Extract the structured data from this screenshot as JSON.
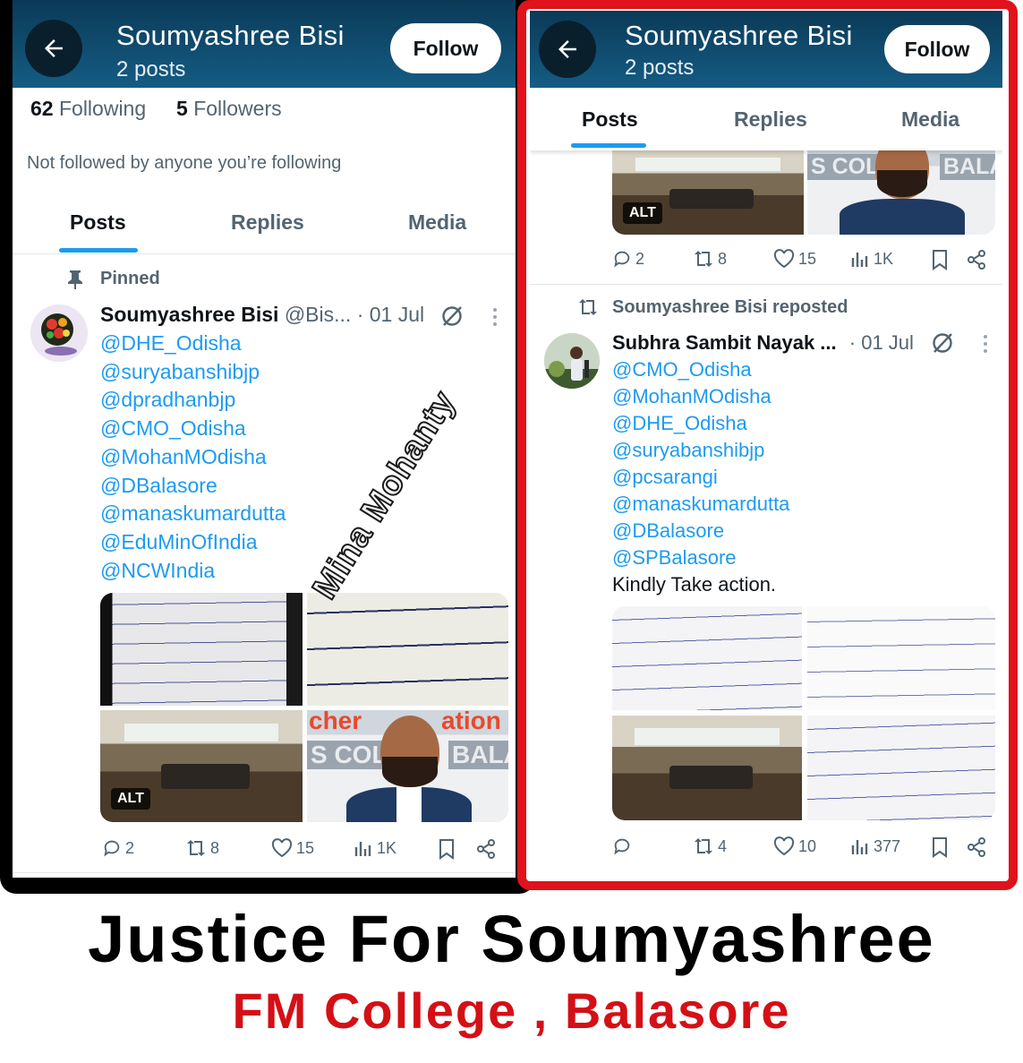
{
  "left_panel": {
    "header": {
      "name": "Soumyashree Bisi",
      "posts": "2 posts",
      "follow_label": "Follow"
    },
    "stats": {
      "following_count": "62",
      "following_label": "Following",
      "followers_count": "5",
      "followers_label": "Followers"
    },
    "not_followed_text": "Not followed by anyone you’re following",
    "tabs": [
      "Posts",
      "Replies",
      "Media"
    ],
    "pinned_label": "Pinned",
    "post": {
      "author": "Soumyashree Bisi",
      "handle": "@Bis...",
      "date": "· 01 Jul",
      "mentions": [
        "@DHE_Odisha",
        "@suryabanshibjp",
        "@dpradhanbjp",
        "@CMO_Odisha",
        "@MohanMOdisha",
        "@DBalasore",
        "@manaskumardutta",
        "@EduMinOfIndia",
        "@NCWIndia"
      ],
      "alt_badge": "ALT",
      "image_text_1": "cher",
      "image_text_2": "ation",
      "image_text_3": "S COLL",
      "image_text_4": "BALA",
      "replies": "2",
      "reposts": "8",
      "likes": "15",
      "views": "1K"
    }
  },
  "right_panel": {
    "header": {
      "name": "Soumyashree Bisi",
      "posts": "2 posts",
      "follow_label": "Follow"
    },
    "tabs": [
      "Posts",
      "Replies",
      "Media"
    ],
    "previous_post": {
      "alt_badge": "ALT",
      "image_text_1": "S COLL",
      "image_text_2": "BALA",
      "replies": "2",
      "reposts": "8",
      "likes": "15",
      "views": "1K"
    },
    "repost_label": "Soumyashree Bisi reposted",
    "post": {
      "author": "Subhra Sambit Nayak ...",
      "date": "· 01 Jul",
      "mentions": [
        "@CMO_Odisha",
        "@MohanMOdisha",
        "@DHE_Odisha",
        "@suryabanshibjp",
        "@pcsarangi",
        "@manaskumardutta",
        "@DBalasore",
        "@SPBalasore"
      ],
      "text": "Kindly Take action.",
      "replies": "",
      "reposts": "4",
      "likes": "10",
      "views": "377"
    }
  },
  "watermark": "Mina Mohanty",
  "caption": {
    "line1": "Justice For Soumyashree",
    "line2": "FM College , Balasore"
  },
  "colors": {
    "header_bg": "#145c84",
    "link_blue": "#1d9bf0",
    "frame_red": "#e0121b",
    "caption_red": "#d41016"
  }
}
